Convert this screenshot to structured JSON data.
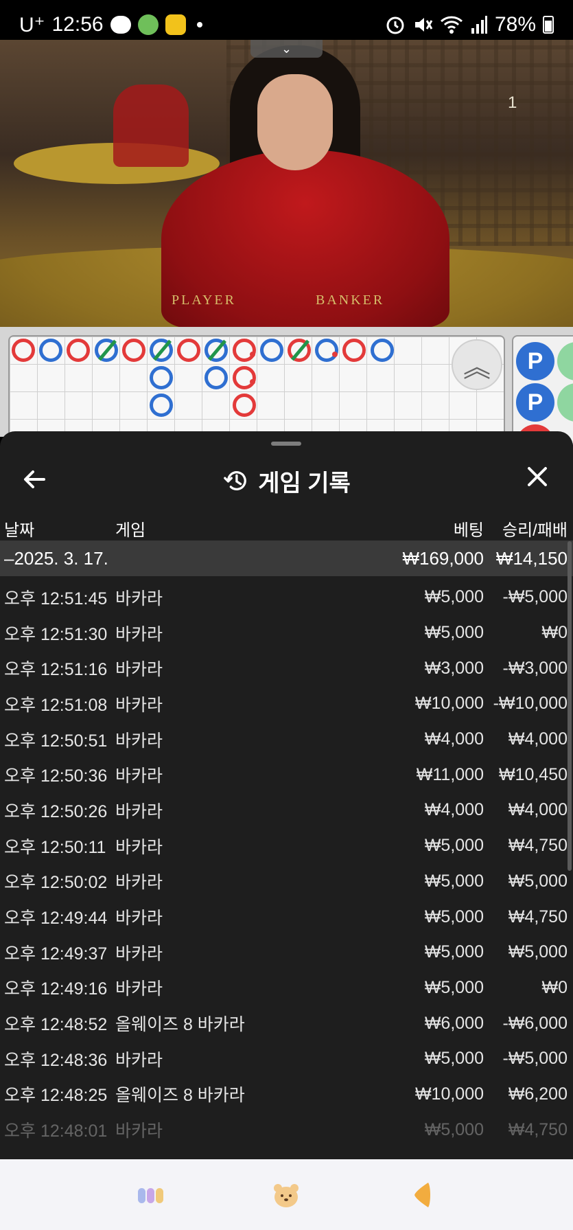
{
  "status_bar": {
    "carrier": "U⁺",
    "time": "12:56",
    "battery": "78%"
  },
  "video": {
    "round_count": "1",
    "table_label_player": "PLAYER",
    "table_label_banker": "BANKER",
    "collapse_icon": "chevron-down-icon"
  },
  "roadmap": {
    "beads": [
      {
        "col": 0,
        "row": 0,
        "c": "r"
      },
      {
        "col": 1,
        "row": 0,
        "c": "b"
      },
      {
        "col": 2,
        "row": 0,
        "c": "r"
      },
      {
        "col": 3,
        "row": 0,
        "c": "b",
        "tie": true
      },
      {
        "col": 4,
        "row": 0,
        "c": "r"
      },
      {
        "col": 5,
        "row": 0,
        "c": "b",
        "tie": true
      },
      {
        "col": 6,
        "row": 0,
        "c": "r"
      },
      {
        "col": 7,
        "row": 0,
        "c": "b",
        "tie": true
      },
      {
        "col": 8,
        "row": 0,
        "c": "r",
        "pair": true
      },
      {
        "col": 9,
        "row": 0,
        "c": "b"
      },
      {
        "col": 10,
        "row": 0,
        "c": "r",
        "tie": true
      },
      {
        "col": 11,
        "row": 0,
        "c": "b",
        "pair": true
      },
      {
        "col": 12,
        "row": 0,
        "c": "r"
      },
      {
        "col": 13,
        "row": 0,
        "c": "b"
      },
      {
        "col": 5,
        "row": 1,
        "c": "b"
      },
      {
        "col": 7,
        "row": 1,
        "c": "b"
      },
      {
        "col": 8,
        "row": 1,
        "c": "r",
        "pair": true
      },
      {
        "col": 5,
        "row": 2,
        "c": "b"
      },
      {
        "col": 8,
        "row": 2,
        "c": "r"
      }
    ],
    "side_label": "P"
  },
  "sheet": {
    "title": "게임 기록",
    "columns": {
      "date": "날짜",
      "game": "게임",
      "bet": "베팅",
      "win_loss": "승리/패배"
    },
    "day_summary": {
      "date": "–2025. 3. 17.",
      "bet": "₩169,000",
      "win_loss": "₩14,150"
    },
    "rows": [
      {
        "time": "오후 12:51:45",
        "game": "바카라",
        "bet": "₩5,000",
        "result": "-₩5,000"
      },
      {
        "time": "오후 12:51:30",
        "game": "바카라",
        "bet": "₩5,000",
        "result": "₩0"
      },
      {
        "time": "오후 12:51:16",
        "game": "바카라",
        "bet": "₩3,000",
        "result": "-₩3,000"
      },
      {
        "time": "오후 12:51:08",
        "game": "바카라",
        "bet": "₩10,000",
        "result": "-₩10,000"
      },
      {
        "time": "오후 12:50:51",
        "game": "바카라",
        "bet": "₩4,000",
        "result": "₩4,000"
      },
      {
        "time": "오후 12:50:36",
        "game": "바카라",
        "bet": "₩11,000",
        "result": "₩10,450"
      },
      {
        "time": "오후 12:50:26",
        "game": "바카라",
        "bet": "₩4,000",
        "result": "₩4,000"
      },
      {
        "time": "오후 12:50:11",
        "game": "바카라",
        "bet": "₩5,000",
        "result": "₩4,750"
      },
      {
        "time": "오후 12:50:02",
        "game": "바카라",
        "bet": "₩5,000",
        "result": "₩5,000"
      },
      {
        "time": "오후 12:49:44",
        "game": "바카라",
        "bet": "₩5,000",
        "result": "₩4,750"
      },
      {
        "time": "오후 12:49:37",
        "game": "바카라",
        "bet": "₩5,000",
        "result": "₩5,000"
      },
      {
        "time": "오후 12:49:16",
        "game": "바카라",
        "bet": "₩5,000",
        "result": "₩0"
      },
      {
        "time": "오후 12:48:52",
        "game": "올웨이즈 8 바카라",
        "bet": "₩6,000",
        "result": "-₩6,000"
      },
      {
        "time": "오후 12:48:36",
        "game": "바카라",
        "bet": "₩5,000",
        "result": "-₩5,000"
      },
      {
        "time": "오후 12:48:25",
        "game": "올웨이즈 8 바카라",
        "bet": "₩10,000",
        "result": "₩6,200"
      },
      {
        "time": "오후 12:48:01",
        "game": "바카라",
        "bet": "₩5,000",
        "result": "₩4,750"
      }
    ]
  },
  "bottom_nav": {
    "items": [
      {
        "icon": "chips-icon"
      },
      {
        "icon": "bear-face-icon"
      },
      {
        "icon": "back-triangle-icon"
      }
    ]
  }
}
